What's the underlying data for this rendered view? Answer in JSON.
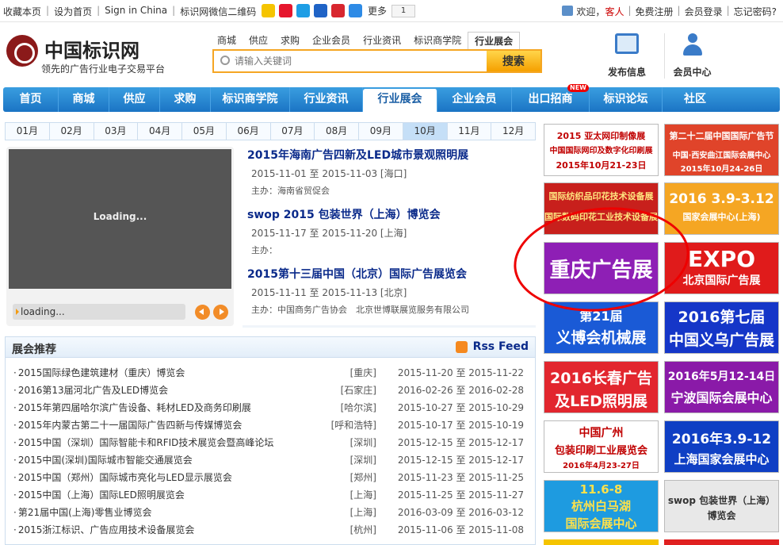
{
  "topbar": {
    "links": [
      "收藏本页",
      "设为首页",
      "Sign in China",
      "标识网微信二维码"
    ],
    "more": "更多",
    "share_count": "1",
    "welcome": "欢迎，",
    "guest": "客人",
    "right_links": [
      "免费注册",
      "会员登录",
      "忘记密码?"
    ]
  },
  "header": {
    "site_name": "中国标识网",
    "slogan": "领先的广告行业电子交易平台",
    "search_tabs": [
      "商城",
      "供应",
      "求购",
      "企业会员",
      "行业资讯",
      "标识商学院",
      "行业展会"
    ],
    "search_placeholder": "请输入关键词",
    "search_button": "搜索",
    "publish": "发布信息",
    "member_center": "会员中心"
  },
  "nav": {
    "items": [
      "首页",
      "商城",
      "供应",
      "求购",
      "标识商学院",
      "行业资讯",
      "行业展会",
      "企业会员",
      "出口招商",
      "标识论坛",
      "社区"
    ],
    "new_badge": "NEW"
  },
  "months": [
    "01月",
    "02月",
    "03月",
    "04月",
    "05月",
    "06月",
    "07月",
    "08月",
    "09月",
    "10月",
    "11月",
    "12月"
  ],
  "slideshow": {
    "loading_main": "Loading...",
    "loading_caption": "loading..."
  },
  "featured": [
    {
      "title": "2015年海南广告四新及LED城市景观照明展",
      "date": "2015-11-01 至 2015-11-03 [海口]",
      "host": "主办：海南省贸促会"
    },
    {
      "title": "swop 2015 包装世界（上海）博览会",
      "date": "2015-11-17 至 2015-11-20 [上海]",
      "host": "主办："
    },
    {
      "title": "2015第十三届中国（北京）国际广告展览会",
      "date": "2015-11-11 至 2015-11-13 [北京]",
      "host": "主办：中国商务广告协会　北京世博联展览服务有限公司"
    }
  ],
  "recommend": {
    "title": "展会推荐",
    "rss": "Rss Feed",
    "rows": [
      {
        "name": "2015国际绿色建筑建材（重庆）博览会",
        "city": "[重庆]",
        "date": "2015-11-20 至 2015-11-22"
      },
      {
        "name": "2016第13届河北广告及LED博览会",
        "city": "[石家庄]",
        "date": "2016-02-26 至 2016-02-28"
      },
      {
        "name": "2015年第四届哈尔滨广告设备、耗材LED及商务印刷展",
        "city": "[哈尔滨]",
        "date": "2015-10-27 至 2015-10-29"
      },
      {
        "name": "2015年内蒙古第二十一届国际广告四新与传媒博览会",
        "city": "[呼和浩特]",
        "date": "2015-10-17 至 2015-10-19"
      },
      {
        "name": "2015中国（深圳）国际智能卡和RFID技术展览会暨高峰论坛",
        "city": "[深圳]",
        "date": "2015-12-15 至 2015-12-17"
      },
      {
        "name": "2015中国(深圳)国际城市智能交通展览会",
        "city": "[深圳]",
        "date": "2015-12-15 至 2015-12-17"
      },
      {
        "name": "2015中国（郑州）国际城市亮化与LED显示展览会",
        "city": "[郑州]",
        "date": "2015-11-23 至 2015-11-25"
      },
      {
        "name": "2015中国（上海）国际LED照明展览会",
        "city": "[上海]",
        "date": "2015-11-25 至 2015-11-27"
      },
      {
        "name": "第21届中国(上海)零售业博览会",
        "city": "[上海]",
        "date": "2016-03-09 至 2016-03-12"
      },
      {
        "name": "2015浙江标识、广告应用技术设备展览会",
        "city": "[杭州]",
        "date": "2015-11-06 至 2015-11-08"
      }
    ]
  },
  "ads": [
    {
      "l1": "2015 亚太网印制像展",
      "l2": "中国国际网印及数字化印刷展",
      "l3": "2015年10月21-23日",
      "bg": "#ffffff",
      "fg": "#c00000"
    },
    {
      "l1": "第二十二届中国国际广告节",
      "l2": "中国·西安曲江国际会展中心",
      "l3": "2015年10月24-26日",
      "bg": "#e0442a",
      "fg": "#ffffff"
    },
    {
      "l1": "国际纺织品印花技术设备展",
      "l2": "国际数码印花工业技术设备展",
      "l3": "",
      "bg": "#c8201c",
      "fg": "#ffe680"
    },
    {
      "l1": "2016 3.9-3.12",
      "l2": "国家会展中心(上海)",
      "l3": "",
      "bg": "#f5a623",
      "fg": "#ffffff"
    },
    {
      "l1": "重庆广告展",
      "l2": "",
      "l3": "",
      "bg": "#8e1fb5",
      "fg": "#ffffff"
    },
    {
      "l1": "EXPO",
      "l2": "北京国际广告展",
      "l3": "",
      "bg": "#e01b1b",
      "fg": "#ffffff"
    },
    {
      "l1": "第21届",
      "l2": "义博会机械展",
      "l3": "",
      "bg": "#1a5ad6",
      "fg": "#ffffff"
    },
    {
      "l1": "2016第七届",
      "l2": "中国义乌广告展",
      "l3": "",
      "bg": "#1536c8",
      "fg": "#ffffff"
    },
    {
      "l1": "2016长春广告",
      "l2": "及LED照明展",
      "l3": "",
      "bg": "#e2262e",
      "fg": "#ffffff"
    },
    {
      "l1": "2016年5月12-14日",
      "l2": "宁波国际会展中心",
      "l3": "",
      "bg": "#8a1aa8",
      "fg": "#ffffff"
    },
    {
      "l1": "中国广州",
      "l2": "包装印刷工业展览会",
      "l3": "2016年4月23-27日",
      "bg": "#ffffff",
      "fg": "#c00000"
    },
    {
      "l1": "2016年3.9-12",
      "l2": "上海国家会展中心",
      "l3": "",
      "bg": "#0f3fc4",
      "fg": "#ffffff"
    },
    {
      "l1": "11.6-8",
      "l2": "杭州白马湖",
      "l3": "国际会展中心",
      "bg": "#1e9be0",
      "fg": "#ffe14a"
    },
    {
      "l1": "swop 包装世界（上海）",
      "l2": "博览会",
      "l3": "",
      "bg": "#e8e8e8",
      "fg": "#333333"
    }
  ]
}
